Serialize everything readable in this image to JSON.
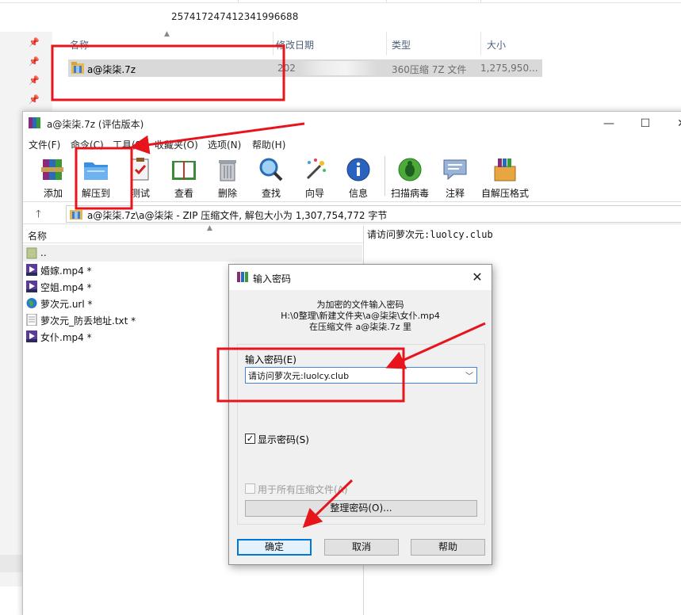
{
  "colors": {
    "annotation": "#e8141b",
    "selection": "#d9d9d9",
    "focus": "#0078d7"
  },
  "explorer": {
    "filename_header": "257417247412341996688",
    "columns": [
      "名称",
      "修改日期",
      "类型",
      "大小"
    ],
    "row": {
      "name": "a@柒柒.7z",
      "date_partial": "202",
      "type": "360压缩 7Z 文件",
      "size": "1,275,950..."
    }
  },
  "rar": {
    "title": "a@柒柒.7z (评估版本)",
    "window_controls": {
      "minimize": "—",
      "maximize": "☐",
      "close": "✕"
    },
    "menu": [
      "文件(F)",
      "命令(C)",
      "工具(S)",
      "收藏夹(O)",
      "选项(N)",
      "帮助(H)"
    ],
    "toolbar": [
      {
        "label": "添加",
        "icon": "add-archive-icon"
      },
      {
        "label": "解压到",
        "icon": "extract-folder-icon"
      },
      {
        "label": "测试",
        "icon": "test-clipboard-icon"
      },
      {
        "label": "查看",
        "icon": "view-book-icon"
      },
      {
        "label": "删除",
        "icon": "delete-trash-icon"
      },
      {
        "label": "查找",
        "icon": "find-magnifier-icon"
      },
      {
        "label": "向导",
        "icon": "wizard-wand-icon"
      },
      {
        "label": "信息",
        "icon": "info-icon"
      },
      {
        "label": "扫描病毒",
        "icon": "virus-scan-icon"
      },
      {
        "label": "注释",
        "icon": "comment-icon"
      },
      {
        "label": "自解压格式",
        "icon": "sfx-box-icon"
      }
    ],
    "address": "a@柒柒.7z\\a@柒柒 - ZIP 压缩文件, 解包大小为 1,307,754,772 字节",
    "list_header": "名称",
    "files": [
      {
        "name": "..",
        "icon": "folder-up-icon"
      },
      {
        "name": "婚嫁.mp4 *",
        "icon": "mp4-file-icon"
      },
      {
        "name": "空姐.mp4 *",
        "icon": "mp4-file-icon"
      },
      {
        "name": "萝次元.url *",
        "icon": "url-globe-icon"
      },
      {
        "name": "萝次元_防丢地址.txt *",
        "icon": "txt-file-icon"
      },
      {
        "name": "女仆.mp4 *",
        "icon": "mp4-file-icon"
      }
    ],
    "comment": "请访问萝次元:luolcy.club"
  },
  "dialog": {
    "title": "输入密码",
    "info_lines": [
      "为加密的文件输入密码",
      "H:\\0整理\\新建文件夹\\a@柒柒\\女仆.mp4",
      "在压缩文件 a@柒柒.7z 里"
    ],
    "password_label": "输入密码(E)",
    "password_value": "请访问萝次元:luolcy.club",
    "show_password_label": "显示密码(S)",
    "show_password_checked": true,
    "use_for_all_label": "用于所有压缩文件(A)",
    "use_for_all_checked": false,
    "organize_button": "整理密码(O)...",
    "ok": "确定",
    "cancel": "取消",
    "help": "帮助"
  }
}
